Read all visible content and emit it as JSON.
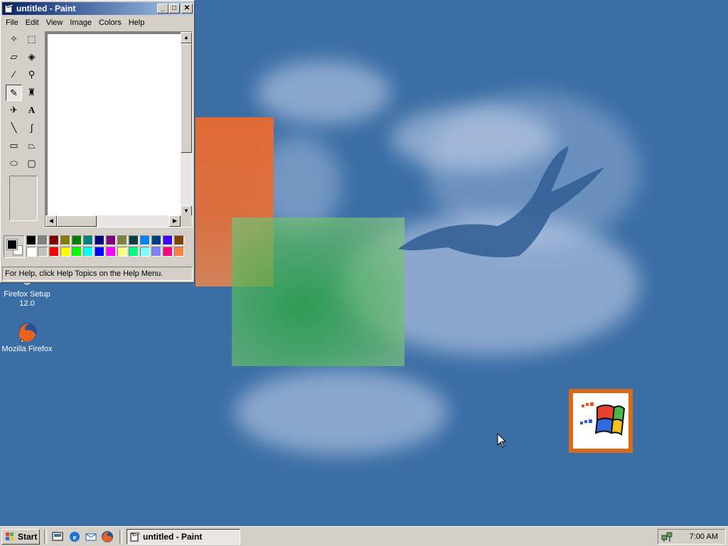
{
  "window": {
    "title": "untitled - Paint",
    "menu": [
      "File",
      "Edit",
      "View",
      "Image",
      "Colors",
      "Help"
    ],
    "status": "For Help, click Help Topics on the Help Menu.",
    "controls": {
      "minimize": "_",
      "maximize": "□",
      "close": "✕"
    }
  },
  "tools": [
    {
      "name": "free-form-select-tool",
      "glyph": "✧"
    },
    {
      "name": "select-tool",
      "glyph": "⬚"
    },
    {
      "name": "eraser-tool",
      "glyph": "▱"
    },
    {
      "name": "fill-tool",
      "glyph": "◈"
    },
    {
      "name": "pick-color-tool",
      "glyph": "⁄"
    },
    {
      "name": "magnifier-tool",
      "glyph": "⚲"
    },
    {
      "name": "pencil-tool",
      "glyph": "✎"
    },
    {
      "name": "brush-tool",
      "glyph": "♜"
    },
    {
      "name": "airbrush-tool",
      "glyph": "✈"
    },
    {
      "name": "text-tool",
      "glyph": "A"
    },
    {
      "name": "line-tool",
      "glyph": "╲"
    },
    {
      "name": "curve-tool",
      "glyph": "∫"
    },
    {
      "name": "rectangle-tool",
      "glyph": "▭"
    },
    {
      "name": "polygon-tool",
      "glyph": "⏢"
    },
    {
      "name": "ellipse-tool",
      "glyph": "⬭"
    },
    {
      "name": "rounded-rectangle-tool",
      "glyph": "▢"
    }
  ],
  "selected_tool": "pencil-tool",
  "palette": {
    "foreground": "#000000",
    "background": "#ffffff",
    "row1": [
      "#000000",
      "#808080",
      "#800000",
      "#808000",
      "#008000",
      "#008080",
      "#000080",
      "#800080",
      "#808040",
      "#004040",
      "#0080ff",
      "#004080",
      "#4000ff",
      "#804000"
    ],
    "row2": [
      "#ffffff",
      "#c0c0c0",
      "#ff0000",
      "#ffff00",
      "#00ff00",
      "#00ffff",
      "#0000ff",
      "#ff00ff",
      "#ffff80",
      "#00ff80",
      "#80ffff",
      "#8080ff",
      "#ff0080",
      "#ff8040"
    ]
  },
  "desktop": {
    "icons": [
      {
        "label_line1": "Firefox Setup",
        "label_line2": "12.0",
        "icon": "firefox-setup-icon"
      },
      {
        "label_line1": "Mozilla Firefox",
        "label_line2": "",
        "icon": "firefox-icon"
      }
    ],
    "colors": {
      "wallpaper": "#3a6ea5"
    }
  },
  "taskbar": {
    "start_label": "Start",
    "quick_launch": [
      "show-desktop-icon",
      "internet-explorer-icon",
      "outlook-express-icon",
      "firefox-icon"
    ],
    "task_button_label": "untitled - Paint",
    "clock": "7:00 AM"
  }
}
